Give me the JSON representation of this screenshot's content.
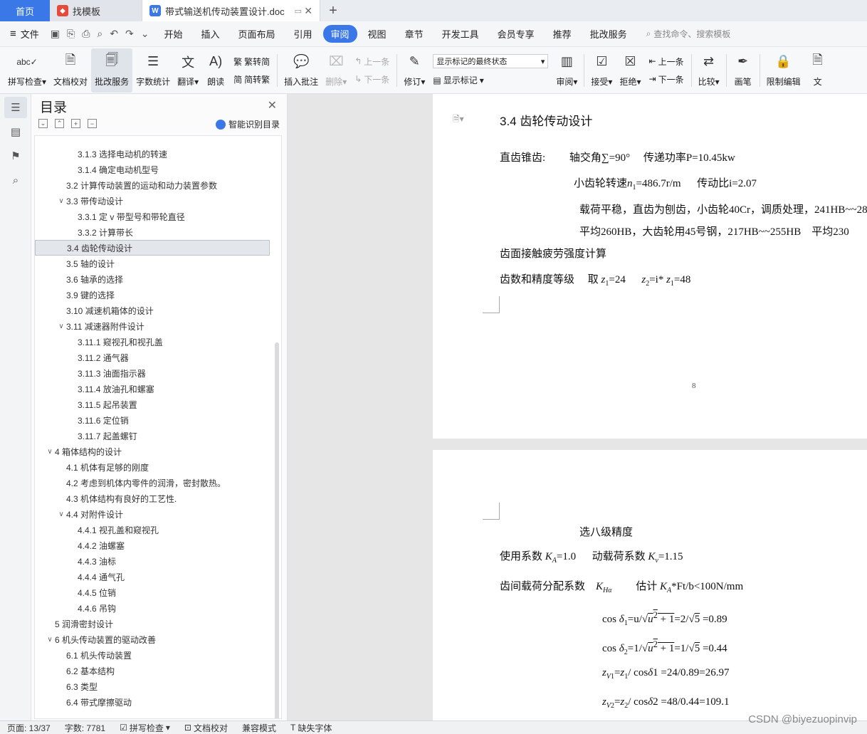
{
  "tabs": {
    "home": "首页",
    "t1": "找模板",
    "t2": "带式输送机传动装置设计.doc"
  },
  "menu": {
    "file": "文件",
    "items": [
      "开始",
      "插入",
      "页面布局",
      "引用",
      "审阅",
      "视图",
      "章节",
      "开发工具",
      "会员专享",
      "推荐",
      "批改服务"
    ],
    "active": "审阅",
    "search": "查找命令、搜索模板"
  },
  "ribbon": {
    "spell": "拼写检查",
    "doccheck": "文档校对",
    "correct": "批改服务",
    "wordcount": "字数统计",
    "translate": "翻译",
    "read": "朗读",
    "trad": "繁转简",
    "simp": "简转繁",
    "insert_comment": "插入批注",
    "delete": "删除",
    "prev": "上一条",
    "next": "下一条",
    "revise": "修订",
    "markup_state": "显示标记的最终状态",
    "show_markup": "显示标记",
    "review": "审阅",
    "accept": "接受",
    "reject": "拒绝",
    "prev2": "上一条",
    "next2": "下一条",
    "compare": "比较",
    "pen": "画笔",
    "restrict": "限制编辑",
    "doc_cut": "文"
  },
  "toc": {
    "title": "目录",
    "ai": "智能识别目录",
    "items": [
      {
        "text": "3.1.3 选择电动机的转速",
        "level": 3
      },
      {
        "text": "3.1.4 确定电动机型号",
        "level": 3
      },
      {
        "text": "3.2 计算传动装置的运动和动力装置参数",
        "level": 2
      },
      {
        "text": "3.3 带传动设计",
        "level": 2,
        "expanded": true
      },
      {
        "text": "3.3.1 定 v 带型号和带轮直径",
        "level": 3
      },
      {
        "text": "3.3.2 计算带长",
        "level": 3
      },
      {
        "text": "3.4 齿轮传动设计",
        "level": 2,
        "selected": true
      },
      {
        "text": "3.5 轴的设计",
        "level": 2
      },
      {
        "text": "3.6 轴承的选择",
        "level": 2
      },
      {
        "text": "3.9 键的选择",
        "level": 2
      },
      {
        "text": "3.10 减速机箱体的设计",
        "level": 2
      },
      {
        "text": "3.11 减速器附件设计",
        "level": 2,
        "expanded": true
      },
      {
        "text": "3.11.1 窥视孔和视孔盖",
        "level": 3
      },
      {
        "text": "3.11.2 通气器",
        "level": 3
      },
      {
        "text": "3.11.3 油面指示器",
        "level": 3
      },
      {
        "text": "3.11.4 放油孔和螺塞",
        "level": 3
      },
      {
        "text": "3.11.5 起吊装置",
        "level": 3
      },
      {
        "text": "3.11.6 定位销",
        "level": 3
      },
      {
        "text": "3.11.7 起盖螺钉",
        "level": 3
      },
      {
        "text": "4 箱体结构的设计",
        "level": 1,
        "expanded": true
      },
      {
        "text": "4.1  机体有足够的刚度",
        "level": 2
      },
      {
        "text": "4.2 考虑到机体内零件的润滑，密封散热。",
        "level": 2
      },
      {
        "text": "4.3 机体结构有良好的工艺性.",
        "level": 2
      },
      {
        "text": "4.4 对附件设计",
        "level": 2,
        "expanded": true
      },
      {
        "text": "4.4.1 视孔盖和窥视孔",
        "level": 3
      },
      {
        "text": "4.4.2  油螺塞",
        "level": 3
      },
      {
        "text": "4.4.3 油标",
        "level": 3
      },
      {
        "text": "4.4.4  通气孔",
        "level": 3
      },
      {
        "text": "4.4.5 位销",
        "level": 3
      },
      {
        "text": "4.4.6  吊钩",
        "level": 3
      },
      {
        "text": "5  润滑密封设计",
        "level": 1
      },
      {
        "text": "6 机头传动装置的驱动改善",
        "level": 1,
        "expanded": true
      },
      {
        "text": "6.1 机头传动装置",
        "level": 2
      },
      {
        "text": "6.2 基本结构",
        "level": 2
      },
      {
        "text": "6.3 类型",
        "level": 2
      },
      {
        "text": "6.4 带式摩擦驱动",
        "level": 2
      }
    ]
  },
  "page1": {
    "heading": "3.4 齿轮传动设计",
    "l1a": "直齿锥齿:",
    "l1b": "轴交角∑=90°",
    "l1c": "传递功率P=10.45kw",
    "l2a": "小齿轮转速",
    "l2b": "=486.7r/m",
    "l2c": "传动比i=2.07",
    "l3": "载荷平稳，直齿为刨齿，小齿轮40Cr，调质处理，241HB~~28",
    "l4": "平均260HB，大齿轮用45号钢，217HB~~255HB　平均230",
    "l5": "齿面接触疲劳强度计算",
    "l6a": "齿数和精度等级",
    "l6b": "取",
    "l6c": "=24",
    "l6d": "=i*",
    "l6e": "=48",
    "pagenum": "8"
  },
  "page2": {
    "p1": "选八级精度",
    "p2a": "使用系数",
    "p2b": "=1.0",
    "p2c": "动载荷系数",
    "p2d": "=1.15",
    "p3a": "齿间载荷分配系数",
    "p3b": "估计",
    "p3c": "*Ft/b<100N/mm",
    "f1": "=u/",
    "f1b": "=2/",
    "f1c": "=0.89",
    "f2": "=1/",
    "f2b": "=1/",
    "f2c": "=0.44",
    "f3": "/ cos",
    "f3b": "1 =24/0.89=26.97",
    "f4": "/ cos",
    "f4b": "2 =48/0.44=109.1"
  },
  "status": {
    "page": "页面: 13/37",
    "words": "字数: 7781",
    "spell": "拼写检查",
    "doccheck": "文档校对",
    "compat": "兼容模式",
    "missingfont": "缺失字体"
  },
  "watermark": "CSDN @biyezuopinvip"
}
